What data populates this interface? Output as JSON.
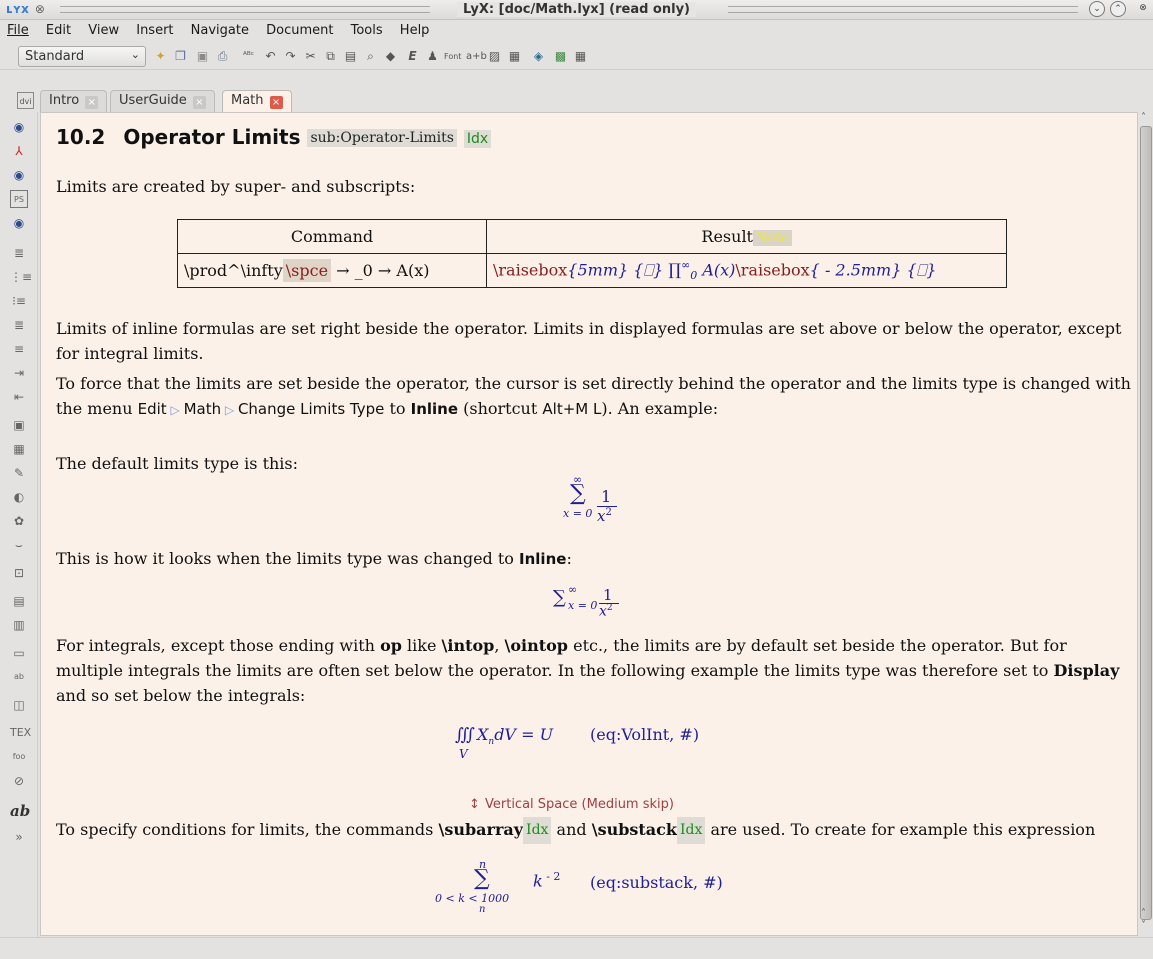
{
  "window": {
    "title": "LyX: [doc/Math.lyx] (read only)"
  },
  "menu": [
    "File",
    "Edit",
    "View",
    "Insert",
    "Navigate",
    "Document",
    "Tools",
    "Help"
  ],
  "toolbar": {
    "layout_value": "Standard"
  },
  "tabs": [
    {
      "label": "Intro",
      "active": false
    },
    {
      "label": "UserGuide",
      "active": false
    },
    {
      "label": "Math",
      "active": true
    }
  ],
  "doc": {
    "section_number": "10.2",
    "section_title": "Operator Limits",
    "section_label": "sub:Operator-Limits",
    "idx": "Idx",
    "p1": "Limits are created by super- and subscripts:",
    "table": {
      "col1_header": "Command",
      "col2_header": "Result",
      "note": "Note",
      "cmd_part1": "\\prod^\\infty",
      "cmd_spce": "\\spce",
      "cmd_part2": "→ _0 → A(x)",
      "result_raise1": "\\raisebox",
      "result_arg1": "{5mm}",
      "result_box1": "{⎕}",
      "result_math": "∏",
      "result_ax": "A(x)",
      "result_raise2": "\\raisebox",
      "result_arg2": "{ - 2.5mm}",
      "result_box2": "{⎕}"
    },
    "p2": "Limits of inline formulas are set right beside the operator. Limits in displayed formulas are set above or below the operator, except for integral limits.",
    "p3a": "To force that the limits are set beside the operator, the cursor is set directly behind the operator and the limits type is changed with the menu",
    "menu_edit": "Edit",
    "menu_math": "Math",
    "menu_change": "Change Limits Type",
    "p3_to": "to",
    "p3_inline": "Inline",
    "p3_shortcut_pre": "(shortcut",
    "shortcut": "Alt+M L",
    "p3_end": "). An example:",
    "p4": "The default limits type is this:",
    "p5a": "This is how it looks when the limits type was changed to",
    "p5b": "Inline",
    "p5c": ":",
    "p6a": "For integrals, except those ending with",
    "p6_op": "op",
    "p6b": "like",
    "p6_intop": "\\intop",
    "p6c": ",",
    "p6_ointop": "\\ointop",
    "p6d": "etc., the limits are by default set beside the operator. But for multiple integrals the limits are often set below the operator. In the following example the limits type was therefore set to",
    "p6_display": "Display",
    "p6e": "and so set below the integrals:",
    "eq_volint_label": "(eq:VolInt, #)",
    "vspace": "Vertical Space (Medium skip)",
    "p7a": "To specify conditions for limits, the commands",
    "p7_subarray": "\\subarray",
    "p7_and": "and",
    "p7_substack": "\\substack",
    "p7b": "are used. To create for example this expression",
    "eq_substack_label": "(eq:substack, #)"
  }
}
